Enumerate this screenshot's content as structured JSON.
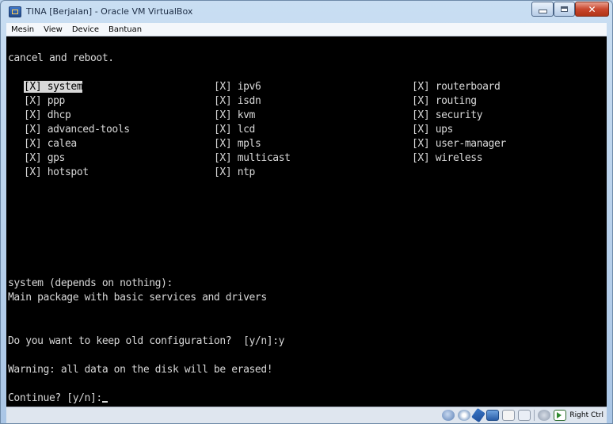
{
  "window": {
    "title": "TINA [Berjalan] - Oracle VM VirtualBox"
  },
  "menu": [
    "Mesin",
    "View",
    "Device",
    "Bantuan"
  ],
  "terminal": {
    "line0": "cancel and reboot.",
    "packages": [
      [
        "[X] system",
        "[X] ipv6",
        "[X] routerboard"
      ],
      [
        "[X] ppp",
        "[X] isdn",
        "[X] routing"
      ],
      [
        "[X] dhcp",
        "[X] kvm",
        "[X] security"
      ],
      [
        "[X] advanced-tools",
        "[X] lcd",
        "[X] ups"
      ],
      [
        "[X] calea",
        "[X] mpls",
        "[X] user-manager"
      ],
      [
        "[X] gps",
        "[X] multicast",
        "[X] wireless"
      ],
      [
        "[X] hotspot",
        "[X] ntp",
        ""
      ]
    ],
    "desc_title": "system (depends on nothing):",
    "desc_text": "Main package with basic services and drivers",
    "prompt_keep": "Do you want to keep old configuration?  [y/n]:y",
    "warning": "Warning: all data on the disk will be erased!",
    "prompt_continue": "Continue? [y/n]:"
  },
  "statusbar": {
    "host_key": "Right Ctrl"
  }
}
